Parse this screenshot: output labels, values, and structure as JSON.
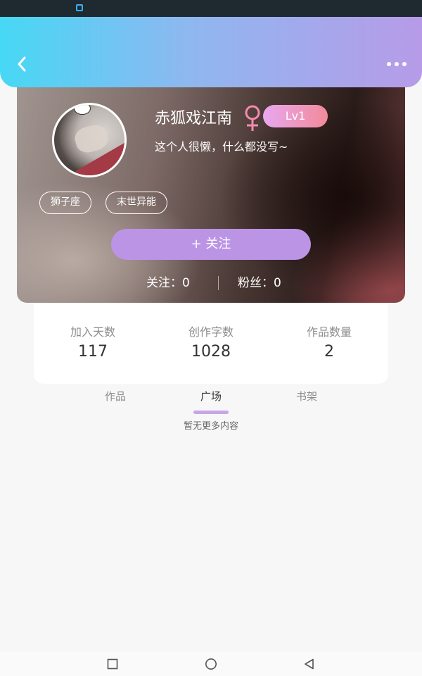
{
  "profile": {
    "username": "赤狐戏江南",
    "gender_icon": "female-icon",
    "level": "Lv1",
    "bio": "这个人很懒，什么都没写~",
    "tags": [
      "狮子座",
      "末世异能"
    ],
    "follow_label": "+ 关注",
    "following_text": "关注：0",
    "fans_text": "粉丝：0"
  },
  "stats": [
    {
      "label": "加入天数",
      "value": "117"
    },
    {
      "label": "创作字数",
      "value": "1028"
    },
    {
      "label": "作品数量",
      "value": "2"
    }
  ],
  "tabs": [
    {
      "label": "作品"
    },
    {
      "label": "广场",
      "active": true
    },
    {
      "label": "书架"
    }
  ],
  "empty_message": "暂无更多内容",
  "colors": {
    "header_gradient": [
      "#46d8f5",
      "#b79be8"
    ],
    "follow_button": "#bb94e6",
    "female_symbol": "#f58ab0",
    "tab_indicator": "#c7a6e8"
  }
}
